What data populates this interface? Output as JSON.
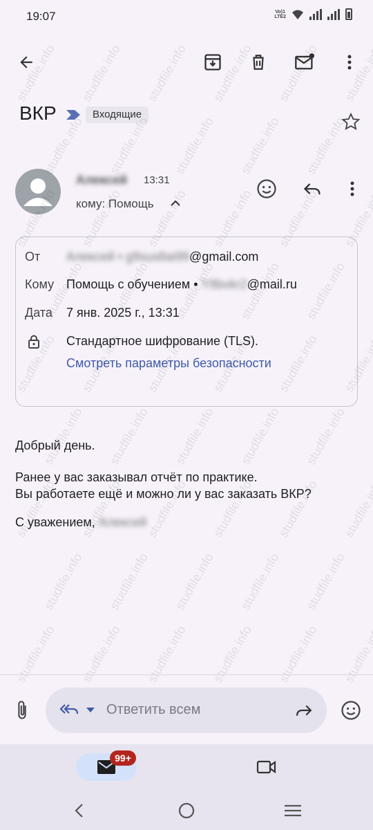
{
  "status_bar": {
    "time": "19:07",
    "volte_label": "VoLTE2",
    "icons": [
      "volte-icon",
      "wifi-icon",
      "signal-icon",
      "signal-icon",
      "battery-icon"
    ]
  },
  "toolbar": {
    "icons": [
      "back-arrow-icon",
      "archive-icon",
      "trash-icon",
      "mark-unread-icon",
      "more-vert-icon"
    ]
  },
  "email": {
    "subject": "ВКР",
    "label": "Входящие",
    "sender_name": "Алексей",
    "time": "13:31",
    "to_line": "кому: Помощь"
  },
  "details": {
    "from_label": "От",
    "from_blurred": "Алексей • g9sus8ai99",
    "from_domain": "@gmail.com",
    "to_label": "Кому",
    "to_name": "Помощь с обучением •",
    "to_blurred": "Y8bvkr2",
    "to_domain": "@mail.ru",
    "date_label": "Дата",
    "date_value": "7 янв. 2025 г., 13:31",
    "encryption": "Стандартное шифрование (TLS).",
    "security_link": "Смотреть параметры безопасности"
  },
  "body": {
    "greeting": "Добрый день.",
    "line1": "Ранее у вас заказывал отчёт по практике.",
    "line2": "Вы работаете ещё и можно ли у вас заказать ВКР?",
    "signoff": "С уважением,",
    "signoff_name": "Алексей"
  },
  "composer": {
    "placeholder": "Ответить всем"
  },
  "bottom_nav": {
    "mail_badge": "99+"
  },
  "watermark": "studfile.info",
  "colors": {
    "background": "#f7f2fa",
    "link": "#3e5ba9",
    "badge": "#b3261e",
    "label_arrow": "#5b6fb5"
  }
}
